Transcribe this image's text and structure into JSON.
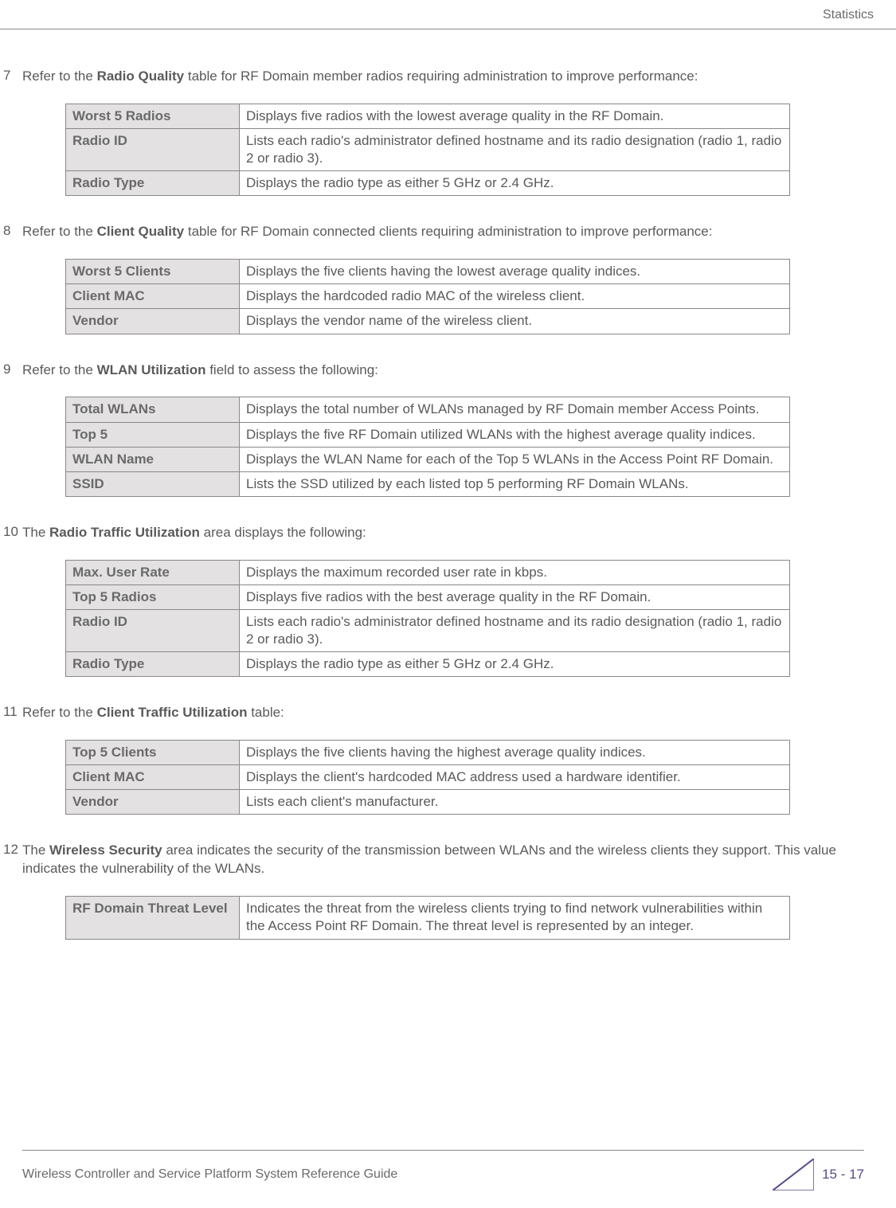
{
  "header": {
    "section": "Statistics"
  },
  "footer": {
    "title": "Wireless Controller and Service Platform System Reference Guide",
    "page": "15 - 17"
  },
  "items": [
    {
      "num": "7",
      "text_pre": "Refer to the ",
      "text_bold": "Radio Quality",
      "text_post": " table for RF Domain member radios requiring administration to improve performance:",
      "rows": [
        {
          "term": "Worst 5 Radios",
          "desc": "Displays five radios with the lowest average quality in the RF Domain."
        },
        {
          "term": "Radio ID",
          "desc": "Lists each radio's administrator defined hostname and its radio designation (radio 1, radio 2 or radio 3)."
        },
        {
          "term": "Radio Type",
          "desc": "Displays the radio type as either 5 GHz or 2.4 GHz."
        }
      ]
    },
    {
      "num": "8",
      "text_pre": "Refer to the ",
      "text_bold": "Client Quality",
      "text_post": " table for RF Domain connected clients requiring administration to improve performance:",
      "rows": [
        {
          "term": "Worst 5 Clients",
          "desc": "Displays the five clients having the lowest average quality indices."
        },
        {
          "term": "Client MAC",
          "desc": "Displays the hardcoded radio MAC of the wireless client."
        },
        {
          "term": "Vendor",
          "desc": "Displays the vendor name of the wireless client."
        }
      ]
    },
    {
      "num": "9",
      "text_pre": "Refer to the ",
      "text_bold": "WLAN Utilization",
      "text_post": " field to assess the following:",
      "rows": [
        {
          "term": "Total WLANs",
          "desc": "Displays the total number of WLANs managed by RF Domain member Access Points."
        },
        {
          "term": "Top 5",
          "desc": "Displays the five RF Domain utilized WLANs with the highest average quality indices."
        },
        {
          "term": "WLAN Name",
          "desc": "Displays the WLAN Name for each of the Top 5 WLANs in the Access Point RF Domain."
        },
        {
          "term": "SSID",
          "desc": "Lists the SSD utilized by each listed top 5 performing RF Domain WLANs."
        }
      ]
    },
    {
      "num": "10",
      "text_pre": "The ",
      "text_bold": "Radio Traffic Utilization",
      "text_post": " area displays the following:",
      "rows": [
        {
          "term": "Max. User Rate",
          "desc": "Displays the maximum recorded user rate in kbps."
        },
        {
          "term": "Top 5 Radios",
          "desc": "Displays five radios with the best average quality in the RF Domain."
        },
        {
          "term": "Radio ID",
          "desc": "Lists each radio's administrator defined hostname and its radio designation (radio 1, radio 2 or radio 3)."
        },
        {
          "term": "Radio Type",
          "desc": "Displays the radio type as either 5 GHz or 2.4 GHz."
        }
      ]
    },
    {
      "num": "11",
      "text_pre": "Refer to the ",
      "text_bold": "Client Traffic Utilization",
      "text_post": " table:",
      "rows": [
        {
          "term": "Top 5 Clients",
          "desc": "Displays the five clients having the highest average quality indices."
        },
        {
          "term": "Client MAC",
          "desc": "Displays the client's hardcoded MAC address used a hardware identifier."
        },
        {
          "term": "Vendor",
          "desc": "Lists each client's manufacturer."
        }
      ]
    },
    {
      "num": "12",
      "text_pre": "The ",
      "text_bold": "Wireless Security",
      "text_post": " area indicates the security of the transmission between WLANs and the wireless clients they support. This value indicates the vulnerability of the WLANs.",
      "rows": [
        {
          "term": "RF Domain Threat Level",
          "desc": "Indicates the threat from the wireless clients trying to find network vulnerabilities within the Access Point RF Domain. The threat level is represented by an integer."
        }
      ]
    }
  ]
}
